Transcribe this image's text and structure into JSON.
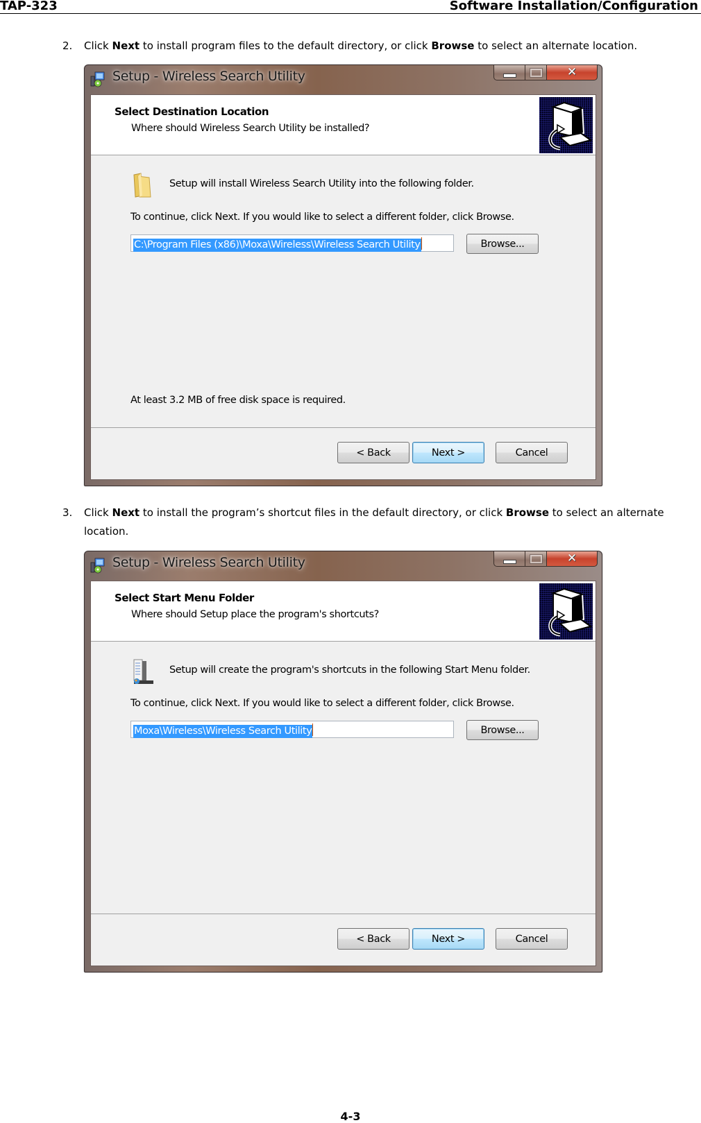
{
  "page_header": {
    "left": "TAP-323",
    "right": "Software Installation/Configuration"
  },
  "steps": [
    {
      "number": "2.",
      "segments": [
        {
          "text": "Click ",
          "bold": false
        },
        {
          "text": "Next",
          "bold": true
        },
        {
          "text": " to install program files to the default directory, or click ",
          "bold": false
        },
        {
          "text": "Browse",
          "bold": true
        },
        {
          "text": " to select an alternate location.",
          "bold": false
        }
      ]
    },
    {
      "number": "3.",
      "segments": [
        {
          "text": "Click ",
          "bold": false
        },
        {
          "text": "Next",
          "bold": true
        },
        {
          "text": " to install the program’s shortcut files in the default directory, or click ",
          "bold": false
        },
        {
          "text": "Browse",
          "bold": true
        },
        {
          "text": " to select an alternate location.",
          "bold": false
        }
      ]
    }
  ],
  "dialogs": [
    {
      "window_title": "Setup - Wireless Search Utility",
      "heading": "Select Destination Location",
      "subheading": "Where should Wireless Search Utility be installed?",
      "icon": "folder-icon",
      "intro_text": "Setup will install Wireless Search Utility into the following folder.",
      "instruction": "To continue, click Next. If you would like to select a different folder, click Browse.",
      "path_value": "C:\\Program Files (x86)\\Moxa\\Wireless\\Wireless Search Utility",
      "browse_label": "Browse...",
      "disk_space_note": "At least 3.2 MB of free disk space is required.",
      "back_label": "< Back",
      "next_label": "Next >",
      "cancel_label": "Cancel"
    },
    {
      "window_title": "Setup - Wireless Search Utility",
      "heading": "Select Start Menu Folder",
      "subheading": "Where should Setup place the program's shortcuts?",
      "icon": "start-menu-icon",
      "intro_text": "Setup will create the program's shortcuts in the following Start Menu folder.",
      "instruction": "To continue, click Next. If you would like to select a different folder, click Browse.",
      "path_value": "Moxa\\Wireless\\Wireless Search Utility",
      "browse_label": "Browse...",
      "back_label": "< Back",
      "next_label": "Next >",
      "cancel_label": "Cancel"
    }
  ],
  "colors": {
    "selection": "#3399ff",
    "default_button": "#bee6fd",
    "close_button": "#c7432d"
  },
  "page_number": "4-3"
}
